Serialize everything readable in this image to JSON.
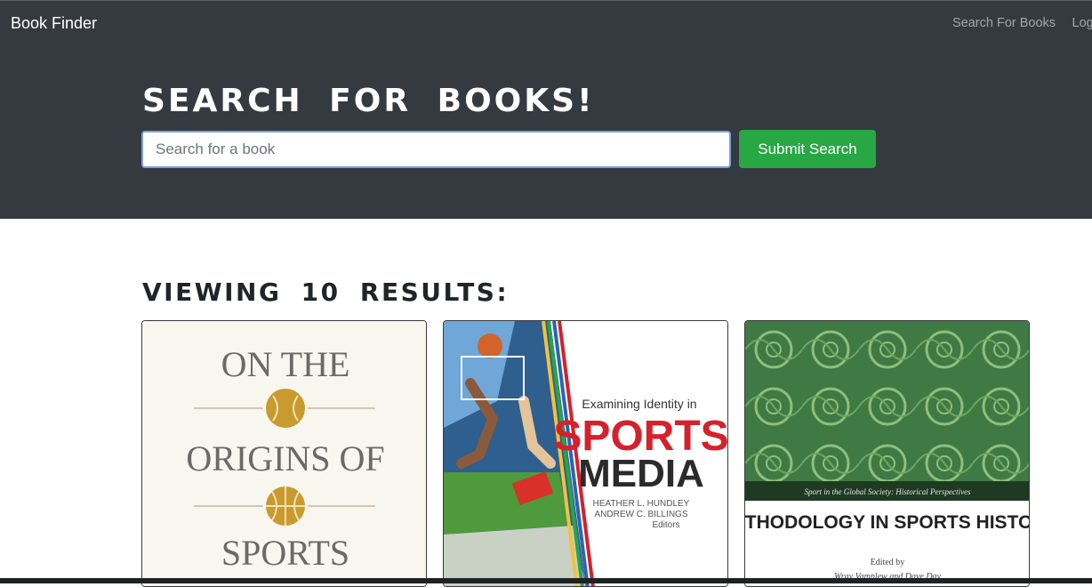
{
  "navbar": {
    "brand": "Book Finder",
    "links": [
      "Search For Books",
      "Log"
    ]
  },
  "hero": {
    "title": "SEARCH FOR BOOKS!",
    "search_placeholder": "Search for a book",
    "search_value": "",
    "submit_label": "Submit Search"
  },
  "results": {
    "heading": "VIEWING 10 RESULTS:",
    "cards": [
      {
        "cover_lines": [
          "ON THE",
          "ORIGINS OF",
          "SPORTS"
        ],
        "ball_icon_1": "baseball-icon",
        "ball_icon_2": "basketball-icon"
      },
      {
        "cover_subtitle": "Examining Identity in",
        "cover_title_1": "SPORTS",
        "cover_title_2": "MEDIA",
        "cover_editors": "HEATHER L. HUNDLEY",
        "cover_editors_2": "ANDREW C. BILLINGS",
        "cover_editors_label": "Editors"
      },
      {
        "cover_series": "Sport in the Global Society: Historical Perspectives",
        "cover_title": "METHODOLOGY IN SPORTS HISTORY",
        "cover_edited_by": "Edited by",
        "cover_editors": "Wray Vamplew and Dave Day"
      }
    ]
  },
  "colors": {
    "navbar_bg": "#343a40",
    "accent_green": "#28a745",
    "cover3_green": "#3f7a45",
    "sports_red": "#d6202a"
  }
}
